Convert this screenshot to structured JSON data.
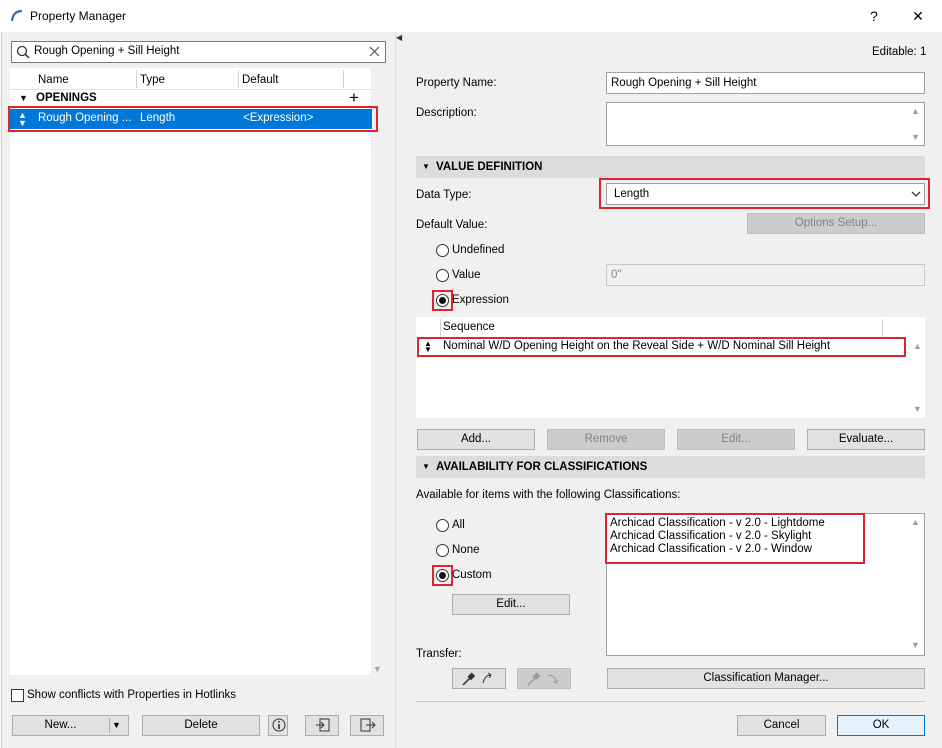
{
  "window": {
    "title": "Property Manager",
    "help": "?",
    "close": "✕"
  },
  "search": {
    "value": "Rough Opening + Sill Height"
  },
  "columns": {
    "name": "Name",
    "type": "Type",
    "default": "Default"
  },
  "group": {
    "label": "OPENINGS",
    "add": "+"
  },
  "row": {
    "name": "Rough Opening ...",
    "type": "Length",
    "default": "<Expression>"
  },
  "left_footer": {
    "checkbox_label": "Show conflicts with Properties in Hotlinks",
    "new_label": "New...",
    "delete_label": "Delete"
  },
  "editable": "Editable: 1",
  "property_name": {
    "label": "Property Name:",
    "value": "Rough Opening + Sill Height"
  },
  "description": {
    "label": "Description:",
    "value": ""
  },
  "value_definition": {
    "header": "VALUE DEFINITION",
    "data_type_label": "Data Type:",
    "data_type_value": "Length",
    "default_value_label": "Default Value:",
    "options_setup": "Options Setup...",
    "undefined": "Undefined",
    "value": "Value",
    "value_field": "0\"",
    "expression": "Expression",
    "sequence_header": "Sequence",
    "sequence_item": "Nominal W/D Opening Height on the Reveal Side + W/D Nominal Sill Height",
    "add": "Add...",
    "remove": "Remove",
    "edit": "Edit...",
    "evaluate": "Evaluate..."
  },
  "availability": {
    "header": "AVAILABILITY FOR CLASSIFICATIONS",
    "intro": "Available for items with the following Classifications:",
    "all": "All",
    "none": "None",
    "custom": "Custom",
    "edit": "Edit...",
    "classifications": [
      "Archicad Classification - v 2.0 - Lightdome",
      "Archicad Classification - v 2.0 - Skylight",
      "Archicad Classification - v 2.0 - Window"
    ],
    "transfer": "Transfer:",
    "classification_manager": "Classification Manager..."
  },
  "footer": {
    "cancel": "Cancel",
    "ok": "OK"
  }
}
